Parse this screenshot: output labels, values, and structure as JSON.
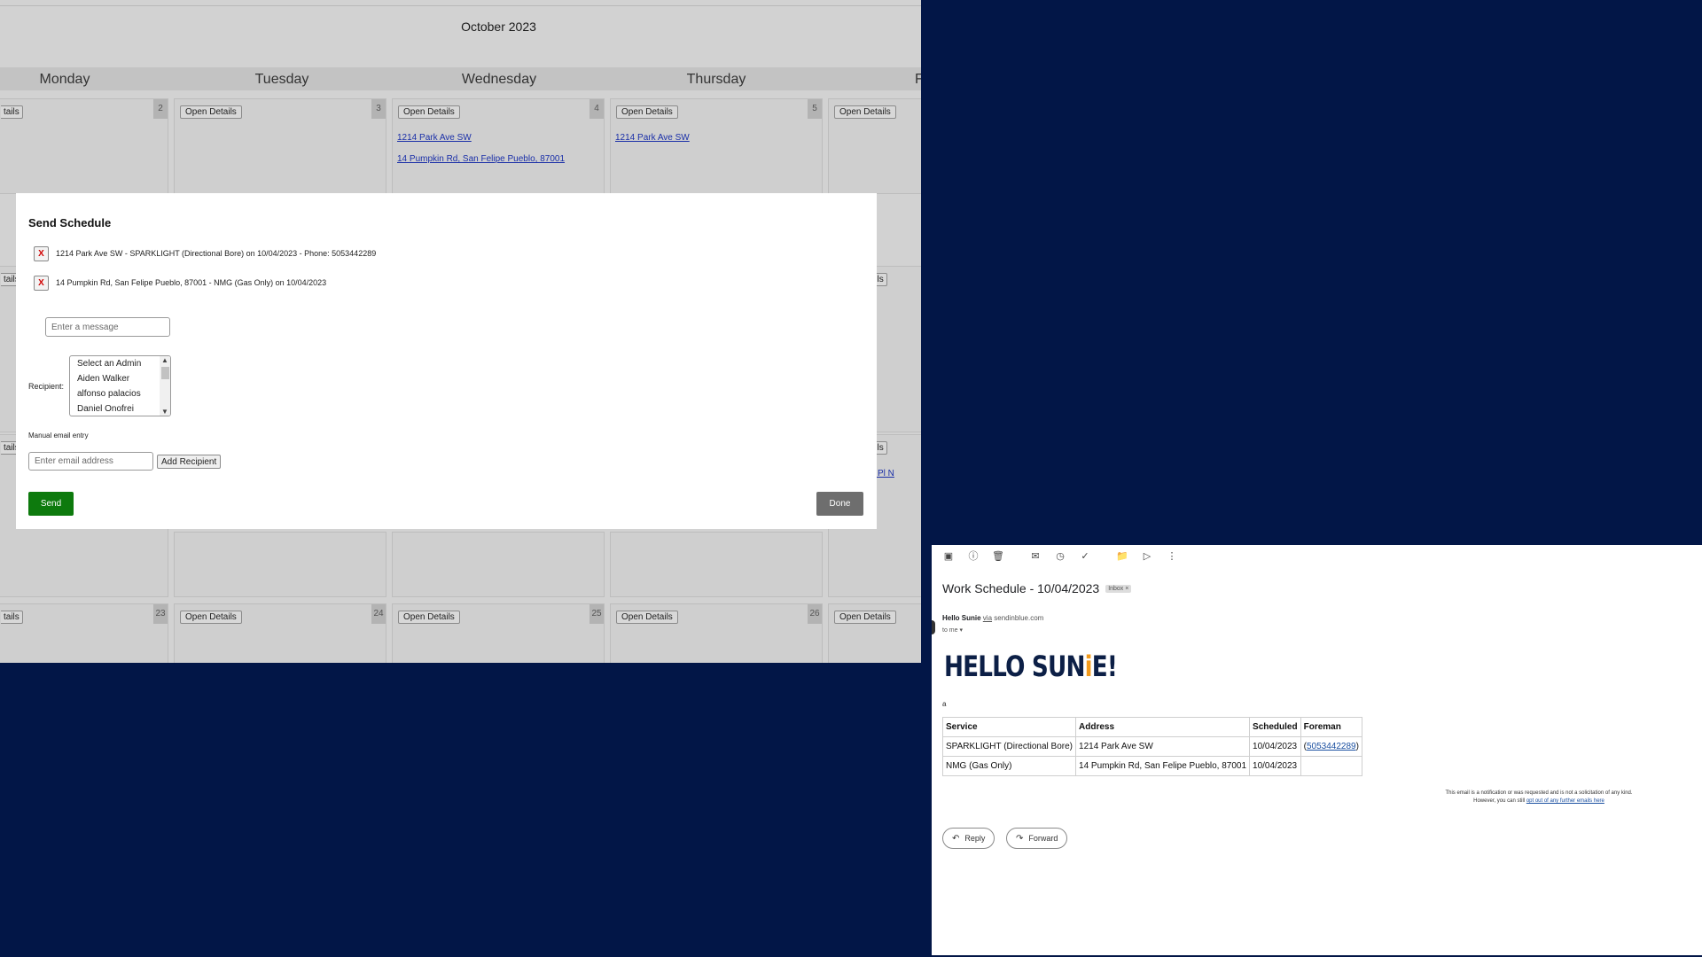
{
  "calendar": {
    "month_title": "October 2023",
    "days": [
      "Monday",
      "Tuesday",
      "Wednesday",
      "Thursday",
      "F"
    ],
    "open_details_label": "Open Details",
    "partial_details_label": "tails",
    "row1_numbers": [
      "2",
      "3",
      "4",
      "5"
    ],
    "row4_numbers": [
      "23",
      "24",
      "25",
      "26"
    ],
    "wed_links": [
      "1214 Park Ave SW",
      "14 Pumpkin Rd, San Felipe Pueblo, 87001"
    ],
    "thu_links": [
      "1214 Park Ave SW"
    ],
    "fri_partial_link": "l Pl N"
  },
  "modal": {
    "title": "Send Schedule",
    "remove_label": "X",
    "schedules": [
      "1214 Park Ave SW - SPARKLIGHT (Directional Bore) on 10/04/2023 - Phone: 5053442289",
      "14 Pumpkin Rd, San Felipe Pueblo, 87001 - NMG (Gas Only) on 10/04/2023"
    ],
    "message_placeholder": "Enter a message",
    "recipient_label": "Recipient:",
    "recipient_options": [
      "Select an Admin",
      "Aiden Walker",
      "alfonso palacios",
      "Daniel Onofrei"
    ],
    "manual_label": "Manual email entry",
    "email_placeholder": "Enter email address",
    "add_recipient_label": "Add Recipient",
    "send_label": "Send",
    "done_label": "Done"
  },
  "email": {
    "toolbar_icons": [
      "archive-icon",
      "report-spam-icon",
      "delete-icon",
      "mark-unread-icon",
      "snooze-icon",
      "add-task-icon",
      "move-to-icon",
      "labels-icon",
      "more-icon"
    ],
    "subject": "Work Schedule - 10/04/2023",
    "inbox_badge": "Inbox ×",
    "sender_name": "Hello Sunie",
    "via": "via",
    "sender_domain": "sendinblue.com",
    "to_me": "to me ▾",
    "logo_text": "HELLO SUNiE!",
    "message_text": "a",
    "table_headers": [
      "Service",
      "Address",
      "Scheduled",
      "Foreman"
    ],
    "table_rows": [
      [
        "SPARKLIGHT (Directional Bore)",
        "1214 Park Ave SW",
        "10/04/2023",
        "5053442289"
      ],
      [
        "NMG (Gas Only)",
        "14 Pumpkin Rd, San Felipe Pueblo, 87001",
        "10/04/2023",
        ""
      ]
    ],
    "disclaimer_line1": "This email is a notification or was requested and is not a solicitation of any kind.",
    "disclaimer_line2": "However, you can still",
    "disclaimer_link": "opt out of any further emails here",
    "reply_label": "Reply",
    "forward_label": "Forward"
  }
}
